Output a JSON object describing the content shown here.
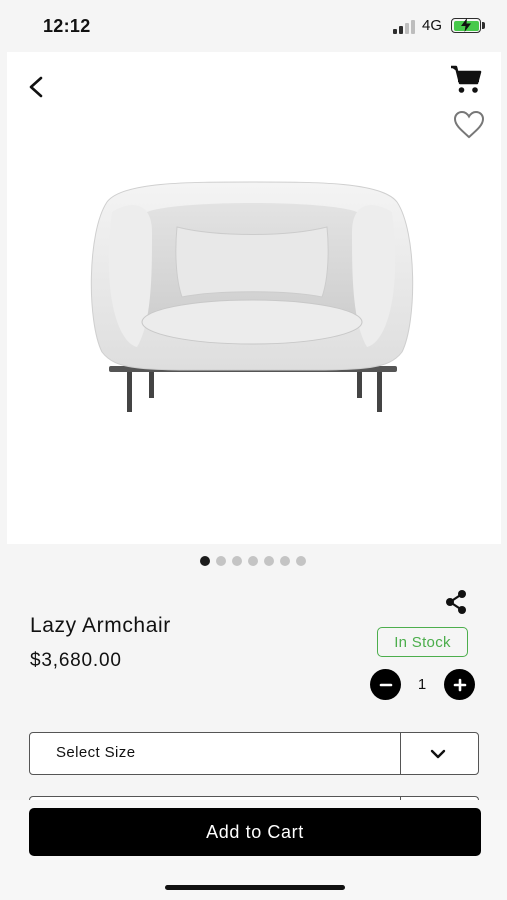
{
  "status_bar": {
    "time": "12:12",
    "network": "4G",
    "battery_color": "#47c94b"
  },
  "header": {
    "back_icon": "chevron-left-icon",
    "cart_icon": "cart-icon",
    "favorite_icon": "heart-outline-icon"
  },
  "carousel": {
    "total_images": 7,
    "active_index": 0
  },
  "product": {
    "name": "Lazy Armchair",
    "price": "$3,680.00",
    "stock_status": "In Stock",
    "quantity": "1",
    "share_icon": "share-icon"
  },
  "options": {
    "size_placeholder": "Select Size"
  },
  "actions": {
    "add_to_cart_label": "Add to Cart"
  },
  "colors": {
    "accent": "#000000",
    "in_stock": "#4cae4c"
  }
}
